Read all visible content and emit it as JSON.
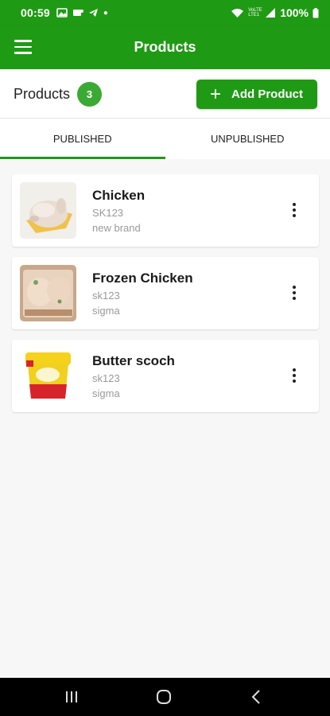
{
  "status_bar": {
    "time": "00:59",
    "battery": "100%",
    "network_label": "VoLTE LTE1"
  },
  "app_bar": {
    "title": "Products",
    "menu_icon": "hamburger-menu-icon"
  },
  "header": {
    "label": "Products",
    "count": "3",
    "add_button_label": "Add Product",
    "add_icon": "plus-icon"
  },
  "tabs": [
    {
      "label": "PUBLISHED",
      "active": true
    },
    {
      "label": "UNPUBLISHED",
      "active": false
    }
  ],
  "products": [
    {
      "name": "Chicken",
      "sku": "SK123",
      "brand": "new brand",
      "image": "raw-chicken-image"
    },
    {
      "name": "Frozen Chicken",
      "sku": "sk123",
      "brand": "sigma",
      "image": "frozen-chicken-image"
    },
    {
      "name": "Butter scoch",
      "sku": "sk123",
      "brand": "sigma",
      "image": "butter-tub-image"
    }
  ],
  "colors": {
    "primary": "#1f9a14",
    "badge": "#3aaa35"
  }
}
